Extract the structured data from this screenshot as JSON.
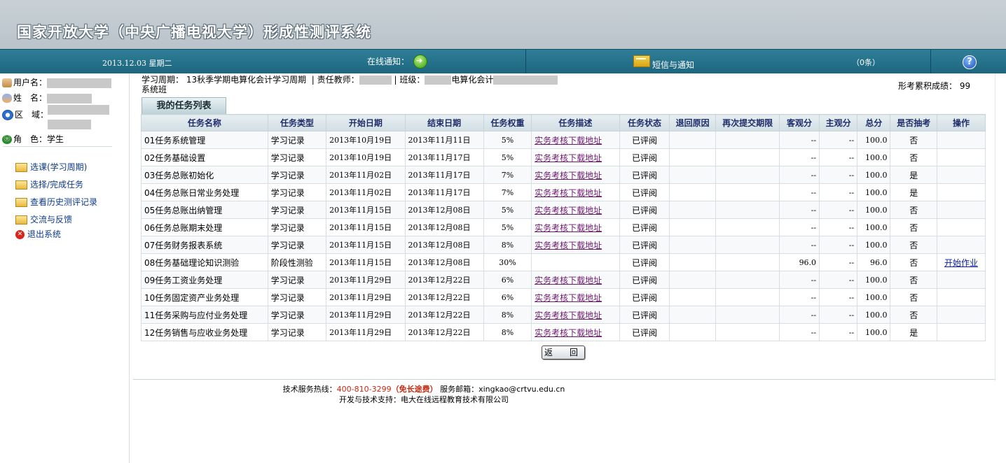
{
  "header": {
    "title": "国家开放大学（中央广播电视大学）形成性测评系统"
  },
  "navbar": {
    "date": "2013.12.03 星期二",
    "online_notice": "在线通知：",
    "sms_label": "短信与通知",
    "count": "（0条）",
    "help": "?"
  },
  "sidebar": {
    "username_label": "用户名：",
    "name_label": "姓　名：",
    "region_label": "区　域：",
    "role_label": "角　色：",
    "role_value": "学生",
    "menu": [
      {
        "label": "选课(学习周期)"
      },
      {
        "label": "选择/完成任务"
      },
      {
        "label": "查看历史测评记录"
      },
      {
        "label": "交流与反馈"
      },
      {
        "label": "退出系统"
      }
    ]
  },
  "info": {
    "period_label": "学习周期：",
    "period_value": "13秋季学期电算化会计学习周期",
    "teacher_label": "责任教师：",
    "class_label": "班级：",
    "class_value": "电算化会计",
    "class_suffix": "系统班",
    "score_label": "形考累积成绩：",
    "score_value": "99"
  },
  "list_title": "我的任务列表",
  "table": {
    "headers": [
      "任务名称",
      "任务类型",
      "开始日期",
      "结束日期",
      "任务权重",
      "任务描述",
      "任务状态",
      "退回原因",
      "再次提交期限",
      "客观分",
      "主观分",
      "总分",
      "是否抽考",
      "操作"
    ],
    "rows": [
      {
        "name": "01任务系统管理",
        "type": "学习记录",
        "start": "2013年10月19日",
        "end": "2013年11月11日",
        "weight": "5%",
        "desc": "实务考核下载地址",
        "status": "已评阅",
        "reason": "",
        "deadline": "",
        "obj": "--",
        "subj": "--",
        "total": "100.0",
        "sample": "否",
        "op": ""
      },
      {
        "name": "02任务基础设置",
        "type": "学习记录",
        "start": "2013年10月19日",
        "end": "2013年11月17日",
        "weight": "5%",
        "desc": "实务考核下载地址",
        "status": "已评阅",
        "reason": "",
        "deadline": "",
        "obj": "--",
        "subj": "--",
        "total": "100.0",
        "sample": "否",
        "op": ""
      },
      {
        "name": "03任务总账初始化",
        "type": "学习记录",
        "start": "2013年11月02日",
        "end": "2013年11月17日",
        "weight": "7%",
        "desc": "实务考核下载地址",
        "status": "已评阅",
        "reason": "",
        "deadline": "",
        "obj": "--",
        "subj": "--",
        "total": "100.0",
        "sample": "是",
        "op": ""
      },
      {
        "name": "04任务总账日常业务处理",
        "type": "学习记录",
        "start": "2013年11月02日",
        "end": "2013年11月17日",
        "weight": "7%",
        "desc": "实务考核下载地址",
        "status": "已评阅",
        "reason": "",
        "deadline": "",
        "obj": "--",
        "subj": "--",
        "total": "100.0",
        "sample": "是",
        "op": ""
      },
      {
        "name": "05任务总账出纳管理",
        "type": "学习记录",
        "start": "2013年11月15日",
        "end": "2013年12月08日",
        "weight": "5%",
        "desc": "实务考核下载地址",
        "status": "已评阅",
        "reason": "",
        "deadline": "",
        "obj": "--",
        "subj": "--",
        "total": "100.0",
        "sample": "否",
        "op": ""
      },
      {
        "name": "06任务总账期末处理",
        "type": "学习记录",
        "start": "2013年11月15日",
        "end": "2013年12月08日",
        "weight": "5%",
        "desc": "实务考核下载地址",
        "status": "已评阅",
        "reason": "",
        "deadline": "",
        "obj": "--",
        "subj": "--",
        "total": "100.0",
        "sample": "否",
        "op": ""
      },
      {
        "name": "07任务财务报表系统",
        "type": "学习记录",
        "start": "2013年11月15日",
        "end": "2013年12月08日",
        "weight": "8%",
        "desc": "实务考核下载地址",
        "status": "已评阅",
        "reason": "",
        "deadline": "",
        "obj": "--",
        "subj": "--",
        "total": "100.0",
        "sample": "否",
        "op": ""
      },
      {
        "name": "08任务基础理论知识测验",
        "type": "阶段性测验",
        "start": "2013年11月15日",
        "end": "2013年12月08日",
        "weight": "30%",
        "desc": "",
        "status": "已评阅",
        "reason": "",
        "deadline": "",
        "obj": "96.0",
        "subj": "--",
        "total": "96.0",
        "sample": "否",
        "op": "开始作业"
      },
      {
        "name": "09任务工资业务处理",
        "type": "学习记录",
        "start": "2013年11月29日",
        "end": "2013年12月22日",
        "weight": "6%",
        "desc": "实务考核下载地址",
        "status": "已评阅",
        "reason": "",
        "deadline": "",
        "obj": "--",
        "subj": "--",
        "total": "100.0",
        "sample": "否",
        "op": ""
      },
      {
        "name": "10任务固定资产业务处理",
        "type": "学习记录",
        "start": "2013年11月29日",
        "end": "2013年12月22日",
        "weight": "6%",
        "desc": "实务考核下载地址",
        "status": "已评阅",
        "reason": "",
        "deadline": "",
        "obj": "--",
        "subj": "--",
        "total": "100.0",
        "sample": "否",
        "op": ""
      },
      {
        "name": "11任务采购与应付业务处理",
        "type": "学习记录",
        "start": "2013年11月29日",
        "end": "2013年12月22日",
        "weight": "8%",
        "desc": "实务考核下载地址",
        "status": "已评阅",
        "reason": "",
        "deadline": "",
        "obj": "--",
        "subj": "--",
        "total": "100.0",
        "sample": "否",
        "op": ""
      },
      {
        "name": "12任务销售与应收业务处理",
        "type": "学习记录",
        "start": "2013年11月29日",
        "end": "2013年12月22日",
        "weight": "8%",
        "desc": "实务考核下载地址",
        "status": "已评阅",
        "reason": "",
        "deadline": "",
        "obj": "--",
        "subj": "--",
        "total": "100.0",
        "sample": "是",
        "op": ""
      }
    ]
  },
  "back_button": "返　回",
  "footer": {
    "hotline_label": "技术服务热线：",
    "hotline_number": "400-810-3299",
    "free": "（免长途费）",
    "email_label": "服务邮箱：",
    "email": "xingkao@crtvu.edu.cn",
    "support": "开发与技术支持：电大在线远程教育技术有限公司"
  }
}
